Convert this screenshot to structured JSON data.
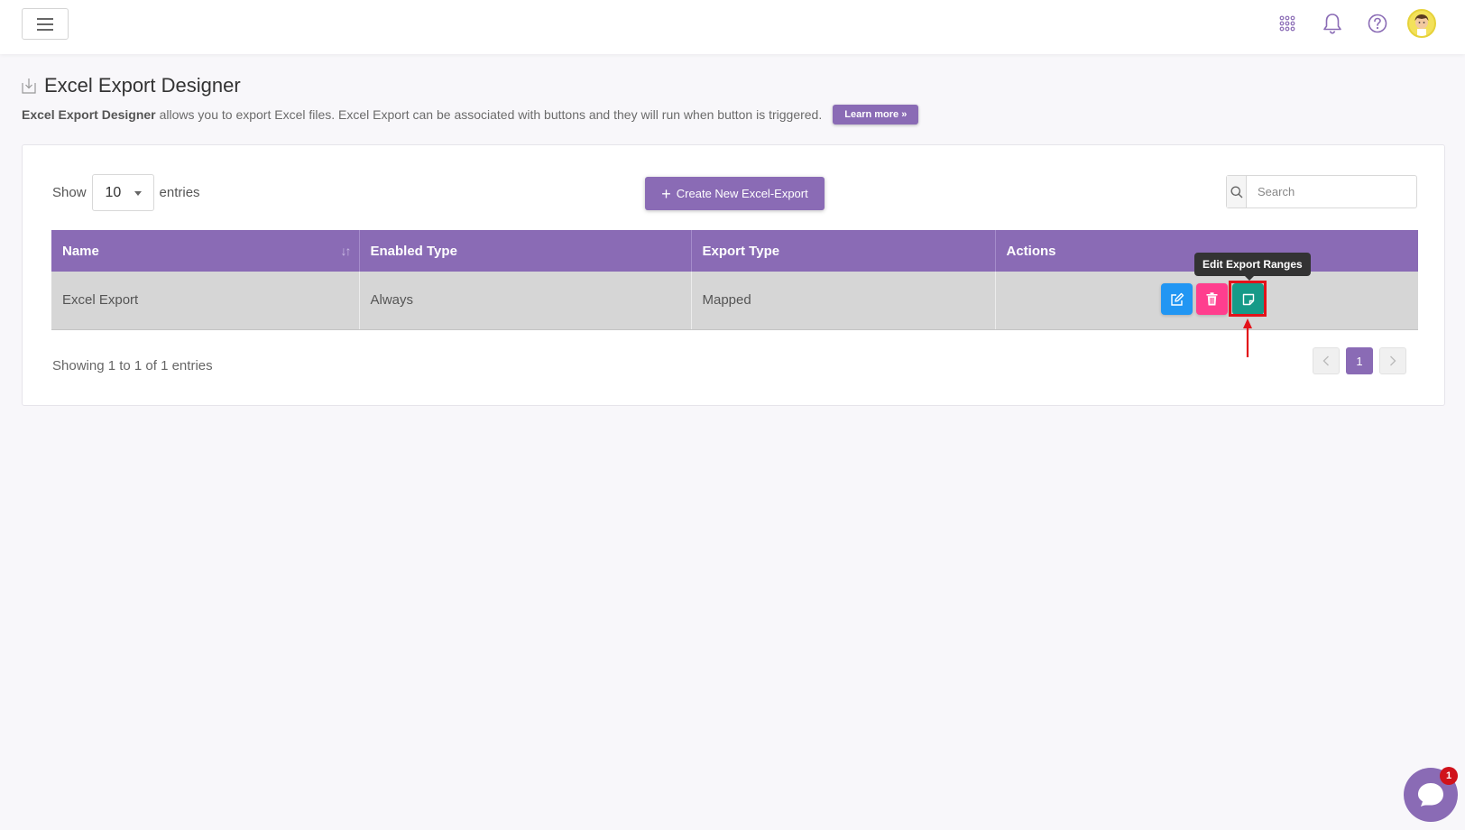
{
  "page": {
    "title": "Excel Export Designer",
    "description_bold": "Excel Export Designer",
    "description_rest": "allows you to export Excel files. Excel Export can be associated with buttons and they will run when button is triggered.",
    "learn_more": "Learn more »"
  },
  "table_controls": {
    "show_label": "Show",
    "page_size": "10",
    "entries_label": "entries",
    "create_button": "Create New Excel-Export",
    "search_placeholder": "Search"
  },
  "table": {
    "headers": [
      "Name",
      "Enabled Type",
      "Export Type",
      "Actions"
    ],
    "rows": [
      {
        "name": "Excel Export",
        "enabled_type": "Always",
        "export_type": "Mapped"
      }
    ]
  },
  "tooltip": "Edit Export Ranges",
  "footer": {
    "showing": "Showing 1 to 1 of 1 entries",
    "current_page": "1"
  },
  "chat": {
    "badge": "1"
  },
  "colors": {
    "accent": "#8a6bb5",
    "edit": "#2196f3",
    "delete": "#ff3e8e",
    "ranges": "#169a88",
    "highlight": "#e3121a"
  }
}
